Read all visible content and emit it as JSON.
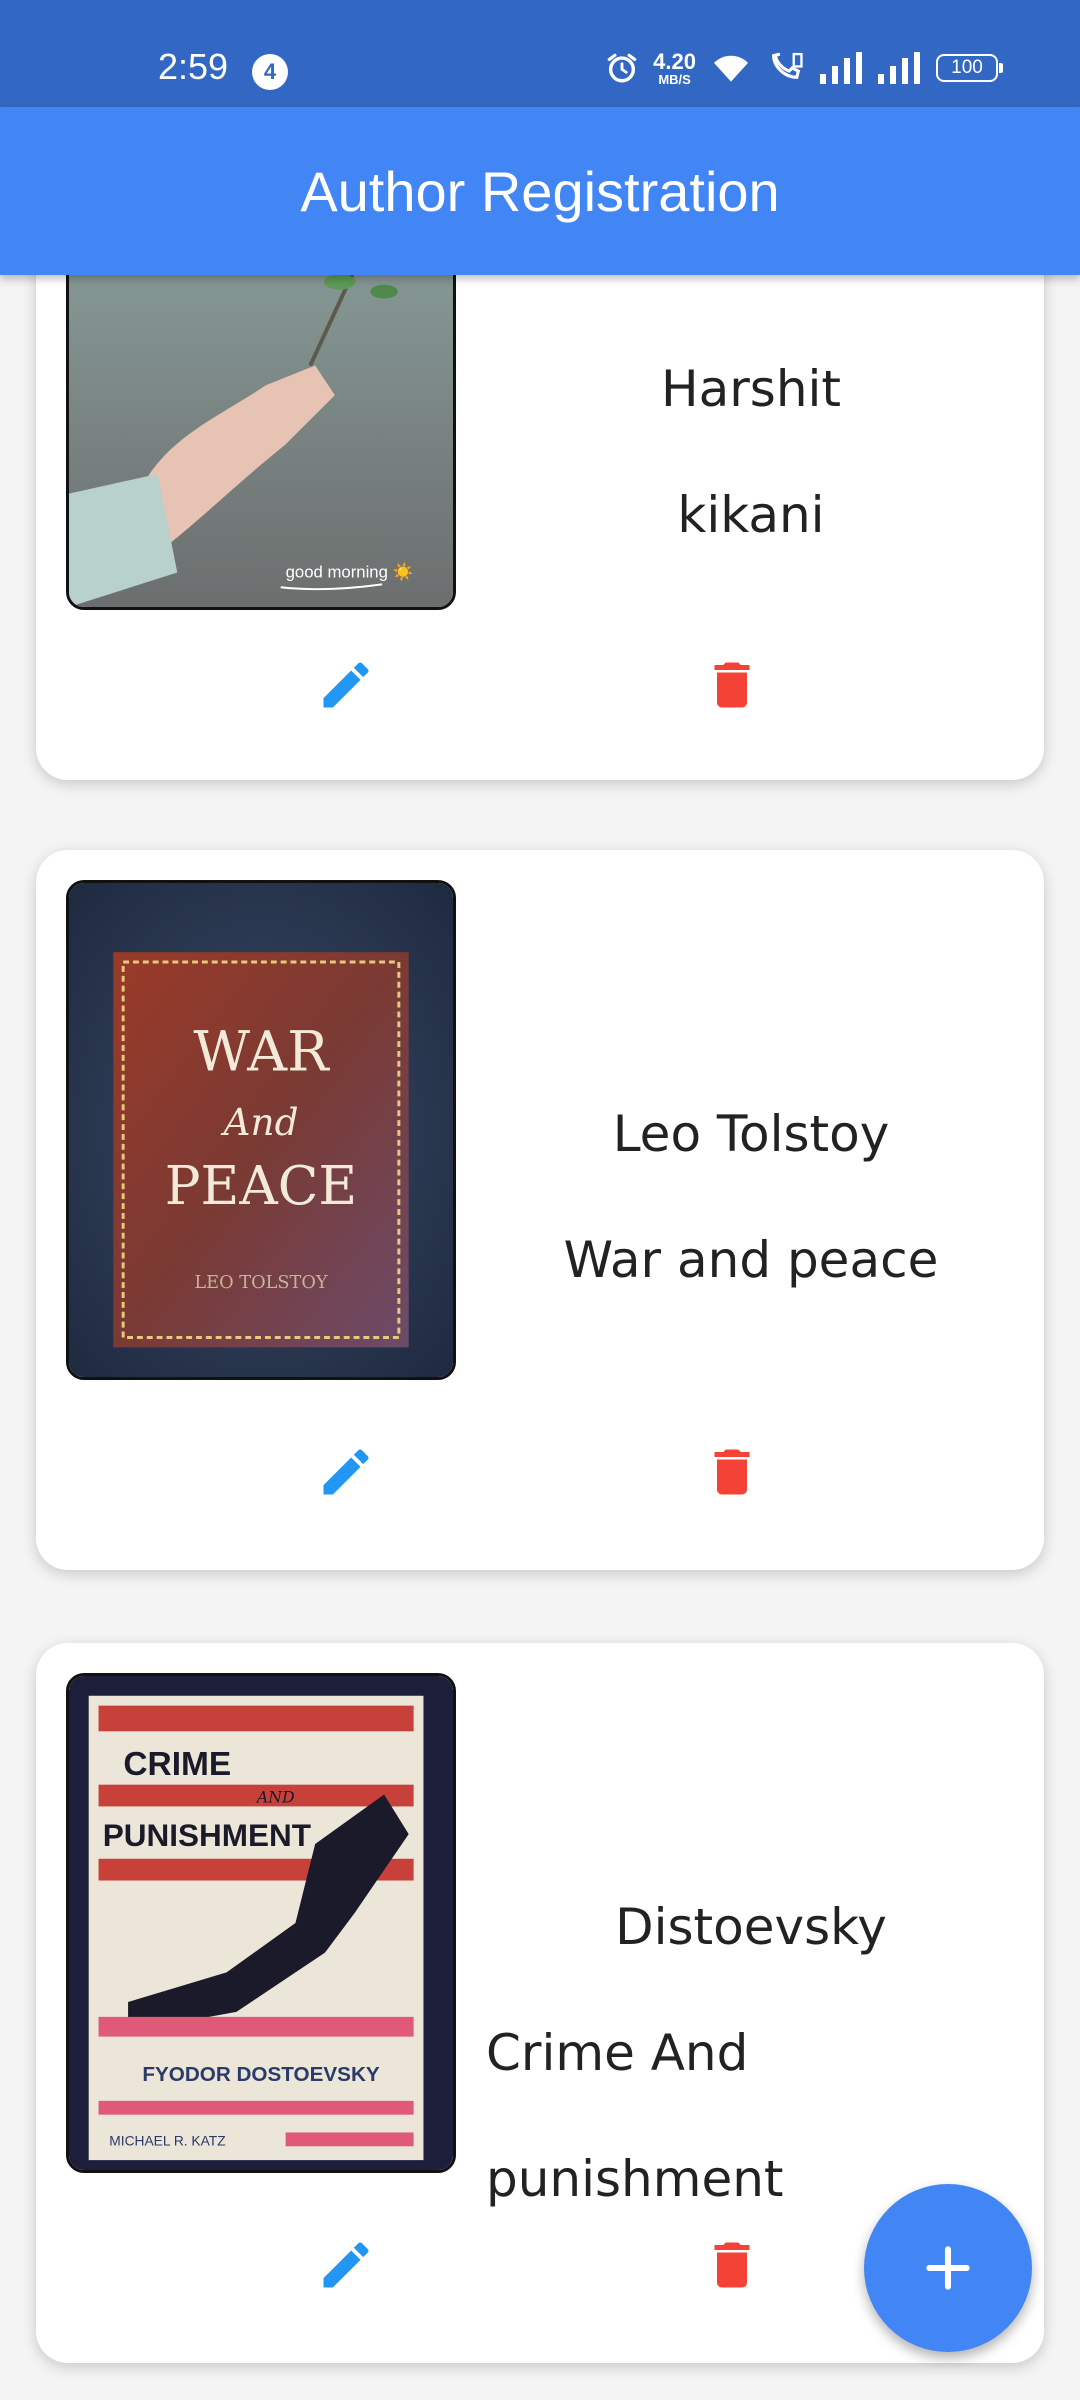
{
  "status_bar": {
    "time": "2:59",
    "notification_count": "4",
    "net_speed_value": "4.20",
    "net_speed_unit": "MB/S",
    "battery": "100"
  },
  "app_bar": {
    "title": "Author Registration"
  },
  "cards": [
    {
      "name": "Harshit",
      "book": "kikani",
      "image_caption": "good morning ☀️",
      "image_type": "hand holding twig photo"
    },
    {
      "name": "Leo Tolstoy",
      "book": "War and peace",
      "image_type": "book cover",
      "cover_title_1": "WAR",
      "cover_title_2": "And",
      "cover_title_3": "PEACE",
      "cover_author": "LEO TOLSTOY"
    },
    {
      "name": "Distoevsky",
      "book_line_1": "Crime And",
      "book_line_2": "punishment",
      "image_type": "book cover",
      "cover_title_1": "CRIME",
      "cover_title_2": "AND",
      "cover_title_3": "PUNISHMENT",
      "cover_author": "FYODOR DOSTOEVSKY",
      "cover_translator": "MICHAEL R. KATZ"
    }
  ],
  "icons": {
    "edit": "pencil-icon",
    "delete": "trash-icon",
    "add": "plus-icon"
  },
  "colors": {
    "status_bar": "#3367c4",
    "app_bar": "#4285f4",
    "edit_icon": "#2196f3",
    "delete_icon": "#f44336",
    "fab": "#4285f4"
  }
}
